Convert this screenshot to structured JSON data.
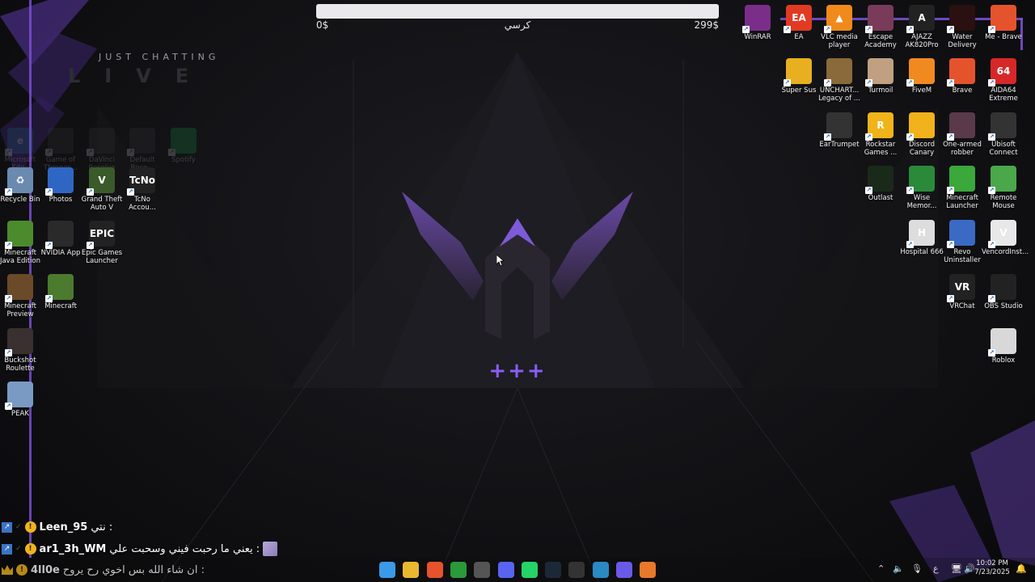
{
  "goal": {
    "min_label": "0$",
    "max_label": "299$",
    "label": "كرسي",
    "progress": 0,
    "fill_color": "#8a5cf6"
  },
  "overlay_logo": {
    "top": "JUST CHATTING",
    "big": "LIVE"
  },
  "center": {
    "symbols": "+++"
  },
  "desktop_icons_left": [
    {
      "label": "Microsoft Edge",
      "icon": "edge-icon",
      "color": "#1e7a9a",
      "glyph": "e",
      "faded": true
    },
    {
      "label": "Game of Thrones...",
      "icon": "got-icon",
      "color": "#444",
      "glyph": "",
      "faded": true
    },
    {
      "label": "DaVinci Resolve",
      "icon": "davinci-icon",
      "color": "#444",
      "glyph": "",
      "faded": true
    },
    {
      "label": "Default Beco...",
      "icon": "default-icon",
      "color": "#444",
      "glyph": "",
      "faded": true
    },
    {
      "label": "Spotify",
      "icon": "spotify-icon",
      "color": "#1db954",
      "glyph": "",
      "faded": true
    },
    {
      "label": "Recycle Bin",
      "icon": "recycle-bin-icon",
      "color": "#6a8ab0",
      "glyph": "♻"
    },
    {
      "label": "Photos",
      "icon": "photos-icon",
      "color": "#2f66c4",
      "glyph": ""
    },
    {
      "label": "Grand Theft Auto V",
      "icon": "gta-icon",
      "color": "#3b5a2a",
      "glyph": "V"
    },
    {
      "label": "TcNo Accou...",
      "icon": "tcno-icon",
      "color": "#222",
      "glyph": "TcNo"
    },
    {
      "label": "Minecraft Java Edition",
      "icon": "minecraft-java-icon",
      "color": "#4c8a2e",
      "glyph": ""
    },
    {
      "label": "NVIDIA App",
      "icon": "nvidia-icon",
      "color": "#2a2a2a",
      "glyph": ""
    },
    {
      "label": "Epic Games Launcher",
      "icon": "epic-icon",
      "color": "#222",
      "glyph": "EPIC"
    },
    {
      "label": "Minecraft Preview",
      "icon": "minecraft-preview-icon",
      "color": "#6b4a2a",
      "glyph": ""
    },
    {
      "label": "Minecraft",
      "icon": "minecraft-icon",
      "color": "#4c7a2e",
      "glyph": ""
    },
    {
      "label": "Buckshot Roulette",
      "icon": "buckshot-icon",
      "color": "#3a3030",
      "glyph": ""
    },
    {
      "label": "PEAK",
      "icon": "peak-icon",
      "color": "#7a9ac4",
      "glyph": ""
    }
  ],
  "desktop_icons_right": [
    {
      "label": "WinRAR",
      "icon": "winrar-icon",
      "color": "#7a2e8a",
      "glyph": ""
    },
    {
      "label": "EA",
      "icon": "ea-icon",
      "color": "#e23a22",
      "glyph": "EA"
    },
    {
      "label": "VLC media player",
      "icon": "vlc-icon",
      "color": "#f08a1a",
      "glyph": "▲"
    },
    {
      "label": "Escape Academy",
      "icon": "escape-academy-icon",
      "color": "#7a3a5a",
      "glyph": ""
    },
    {
      "label": "AJAZZ AK820Pro",
      "icon": "ajazz-icon",
      "color": "#222",
      "glyph": "A"
    },
    {
      "label": "Water Delivery",
      "icon": "water-delivery-icon",
      "color": "#2a1010",
      "glyph": ""
    },
    {
      "label": "Me - Brave",
      "icon": "me-brave-icon",
      "color": "#e5532d",
      "glyph": ""
    },
    {
      "label": "Super Sus",
      "icon": "super-sus-icon",
      "color": "#e8b020",
      "glyph": ""
    },
    {
      "label": "UNCHART... Legacy of ...",
      "icon": "uncharted-icon",
      "color": "#8a6a3a",
      "glyph": ""
    },
    {
      "label": "Turmoil",
      "icon": "turmoil-icon",
      "color": "#c0a080",
      "glyph": ""
    },
    {
      "label": "FiveM",
      "icon": "fivem-icon",
      "color": "#f08a20",
      "glyph": ""
    },
    {
      "label": "Brave",
      "icon": "brave-icon",
      "color": "#e5532d",
      "glyph": ""
    },
    {
      "label": "AIDA64 Extreme",
      "icon": "aida64-icon",
      "color": "#d62828",
      "glyph": "64"
    },
    {
      "label": "EarTrumpet",
      "icon": "eartrumpet-icon",
      "color": "#333",
      "glyph": ""
    },
    {
      "label": "Rockstar Games ...",
      "icon": "rockstar-icon",
      "color": "#f0b41a",
      "glyph": "R"
    },
    {
      "label": "Discord Canary",
      "icon": "discord-canary-icon",
      "color": "#f2b21b",
      "glyph": ""
    },
    {
      "label": "One-armed robber",
      "icon": "one-armed-robber-icon",
      "color": "#5a3a4a",
      "glyph": ""
    },
    {
      "label": "Ubisoft Connect",
      "icon": "ubisoft-icon",
      "color": "#333",
      "glyph": ""
    },
    {
      "label": "Outlast",
      "icon": "outlast-icon",
      "color": "#1a2a1a",
      "glyph": ""
    },
    {
      "label": "Wise Memor...",
      "icon": "wise-memory-icon",
      "color": "#2a8a3a",
      "glyph": ""
    },
    {
      "label": "Minecraft Launcher",
      "icon": "minecraft-launcher-icon",
      "color": "#3aa83a",
      "glyph": ""
    },
    {
      "label": "Remote Mouse",
      "icon": "remote-mouse-icon",
      "color": "#4aa84a",
      "glyph": ""
    },
    {
      "label": "Hospital 666",
      "icon": "hospital-666-icon",
      "color": "#ddd",
      "glyph": "H"
    },
    {
      "label": "Revo Uninstaller",
      "icon": "revo-icon",
      "color": "#3a6ac4",
      "glyph": ""
    },
    {
      "label": "VencordInst...",
      "icon": "vencord-icon",
      "color": "#e8e8e8",
      "glyph": "V"
    },
    {
      "label": "VRChat",
      "icon": "vrchat-icon",
      "color": "#222",
      "glyph": "VR"
    },
    {
      "label": "OBS Studio",
      "icon": "obs-icon",
      "color": "#222",
      "glyph": ""
    },
    {
      "label": "Roblox",
      "icon": "roblox-icon",
      "color": "#d8d8d8",
      "glyph": ""
    }
  ],
  "chat": [
    {
      "name": "Leen_95",
      "message": "نتي :"
    },
    {
      "name": "ar1_3h_WM",
      "message": "يعني ما رحبت فيني وسحبت علي :"
    },
    {
      "name": "4ll0e",
      "message": "ان شاء الله بس اخوي رح يروح :"
    }
  ],
  "taskbar": {
    "items": [
      {
        "icon": "windows-start-icon",
        "color": "#3a9ae8"
      },
      {
        "icon": "file-explorer-icon",
        "color": "#e8b830"
      },
      {
        "icon": "brave-taskbar-icon",
        "color": "#e5532d"
      },
      {
        "icon": "xbox-icon",
        "color": "#2a9a3a"
      },
      {
        "icon": "obs-taskbar-icon",
        "color": "#555"
      },
      {
        "icon": "discord-taskbar-icon",
        "color": "#5865f2"
      },
      {
        "icon": "whatsapp-icon",
        "color": "#25d366"
      },
      {
        "icon": "steam-icon",
        "color": "#1b2838"
      },
      {
        "icon": "tcno-taskbar-icon",
        "color": "#333"
      },
      {
        "icon": "app-taskbar-icon",
        "color": "#2a8ac4"
      },
      {
        "icon": "linear-taskbar-icon",
        "color": "#6a5ae8"
      },
      {
        "icon": "ajazz-taskbar-icon",
        "color": "#e8782a"
      }
    ],
    "tray": {
      "lang": "ع"
    },
    "clock": {
      "time": "10:02 PM",
      "date": "7/23/2025"
    }
  }
}
